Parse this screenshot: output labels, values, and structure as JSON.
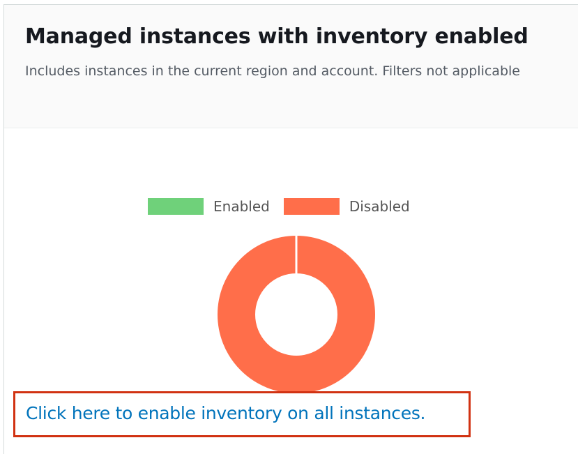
{
  "header": {
    "title": "Managed instances with inventory enabled",
    "description": "Includes instances in the current region and account. Filters not applicable"
  },
  "chart_data": {
    "type": "pie",
    "title": "",
    "legend": [
      {
        "label": "Enabled",
        "color": "#6fd17a"
      },
      {
        "label": "Disabled",
        "color": "#ff6e4a"
      }
    ],
    "categories": [
      "Enabled",
      "Disabled"
    ],
    "values": [
      0,
      100
    ],
    "donut": true,
    "legend_position": "top"
  },
  "cta": {
    "link_text": "Click here to enable inventory on all instances.",
    "highlight_color": "#d13212"
  }
}
